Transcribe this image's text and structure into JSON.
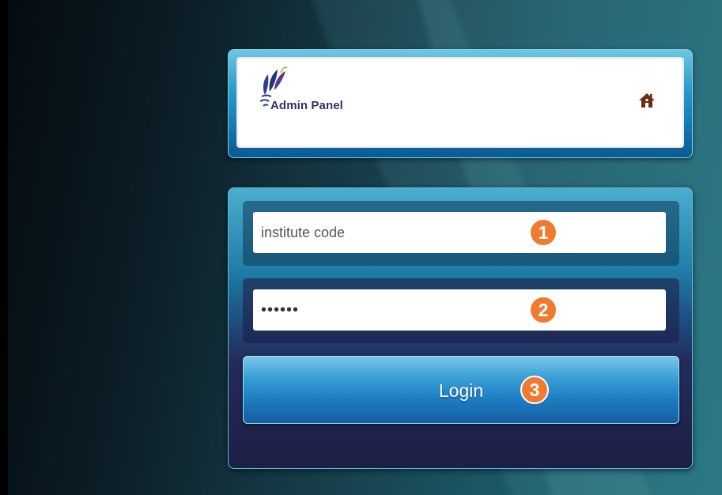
{
  "header": {
    "brand": "Admin Panel",
    "logo_icon": "feather-logo-icon",
    "home_icon": "home-icon"
  },
  "form": {
    "institute_code": {
      "placeholder": "institute code",
      "value": ""
    },
    "password": {
      "value": "••••••"
    },
    "login_label": "Login"
  },
  "callouts": [
    "1",
    "2",
    "3"
  ],
  "colors": {
    "frame_blue": "#1379b7",
    "button_blue": "#1c7cc2",
    "badge_orange": "#f07a30",
    "brand_text": "#3a2f66",
    "home_icon": "#6b2e14"
  }
}
